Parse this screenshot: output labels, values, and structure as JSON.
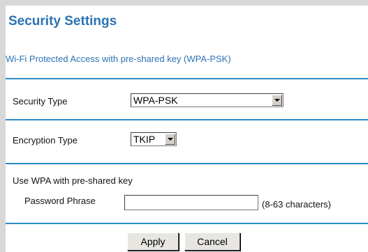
{
  "header": {
    "title": "Security Settings",
    "subtitle": "Wi-Fi Protected Access with pre-shared key (WPA-PSK)"
  },
  "security_type": {
    "label": "Security Type",
    "selected": "WPA-PSK"
  },
  "encryption_type": {
    "label": "Encryption Type",
    "selected": "TKIP"
  },
  "wpa_section": {
    "heading": "Use WPA with pre-shared key",
    "password_label": "Password Phrase",
    "password_value": "",
    "hint": "(8-63 characters)"
  },
  "actions": {
    "apply_label": "Apply",
    "cancel_label": "Cancel"
  },
  "colors": {
    "accent": "#2b73b4",
    "divider": "#2b8ac6",
    "frame": "#d8d8d8"
  }
}
